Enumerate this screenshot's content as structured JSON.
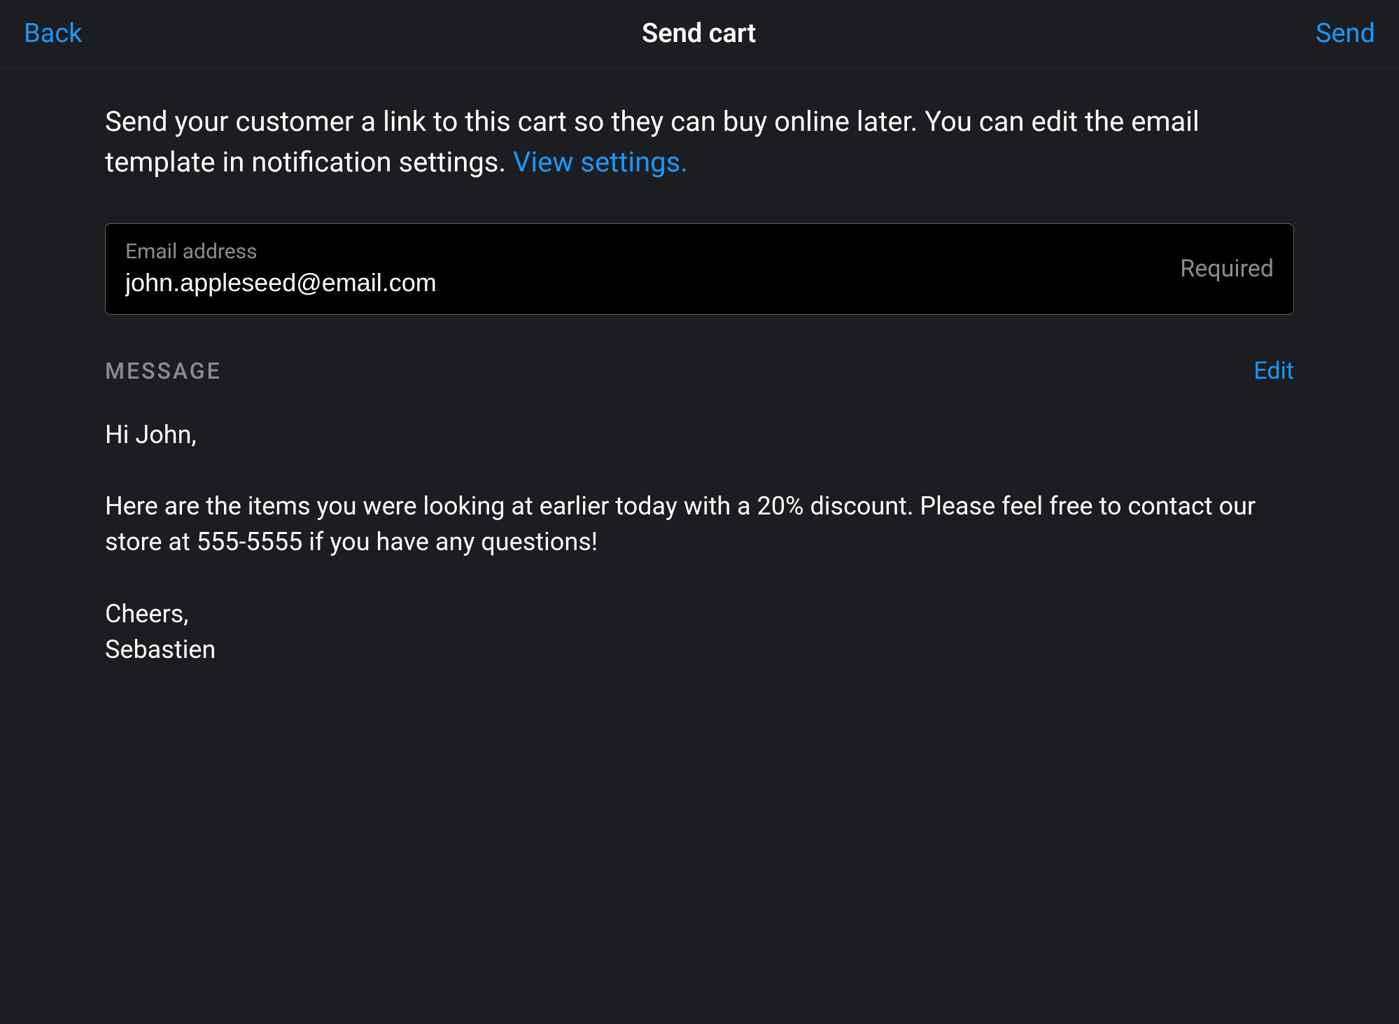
{
  "header": {
    "back_label": "Back",
    "title": "Send cart",
    "send_label": "Send"
  },
  "description": {
    "text": "Send your customer a link to this cart so they can buy online later. You can edit the email template in notification settings. ",
    "link_text": "View settings."
  },
  "email": {
    "label": "Email address",
    "value": "john.appleseed@email.com",
    "required_label": "Required"
  },
  "message": {
    "section_label": "MESSAGE",
    "edit_label": "Edit",
    "body": "Hi John,\n\nHere are the items you were looking at earlier today with a 20% discount. Please feel free to contact our store at 555-5555 if you have any questions!\n\nCheers,\nSebastien"
  }
}
